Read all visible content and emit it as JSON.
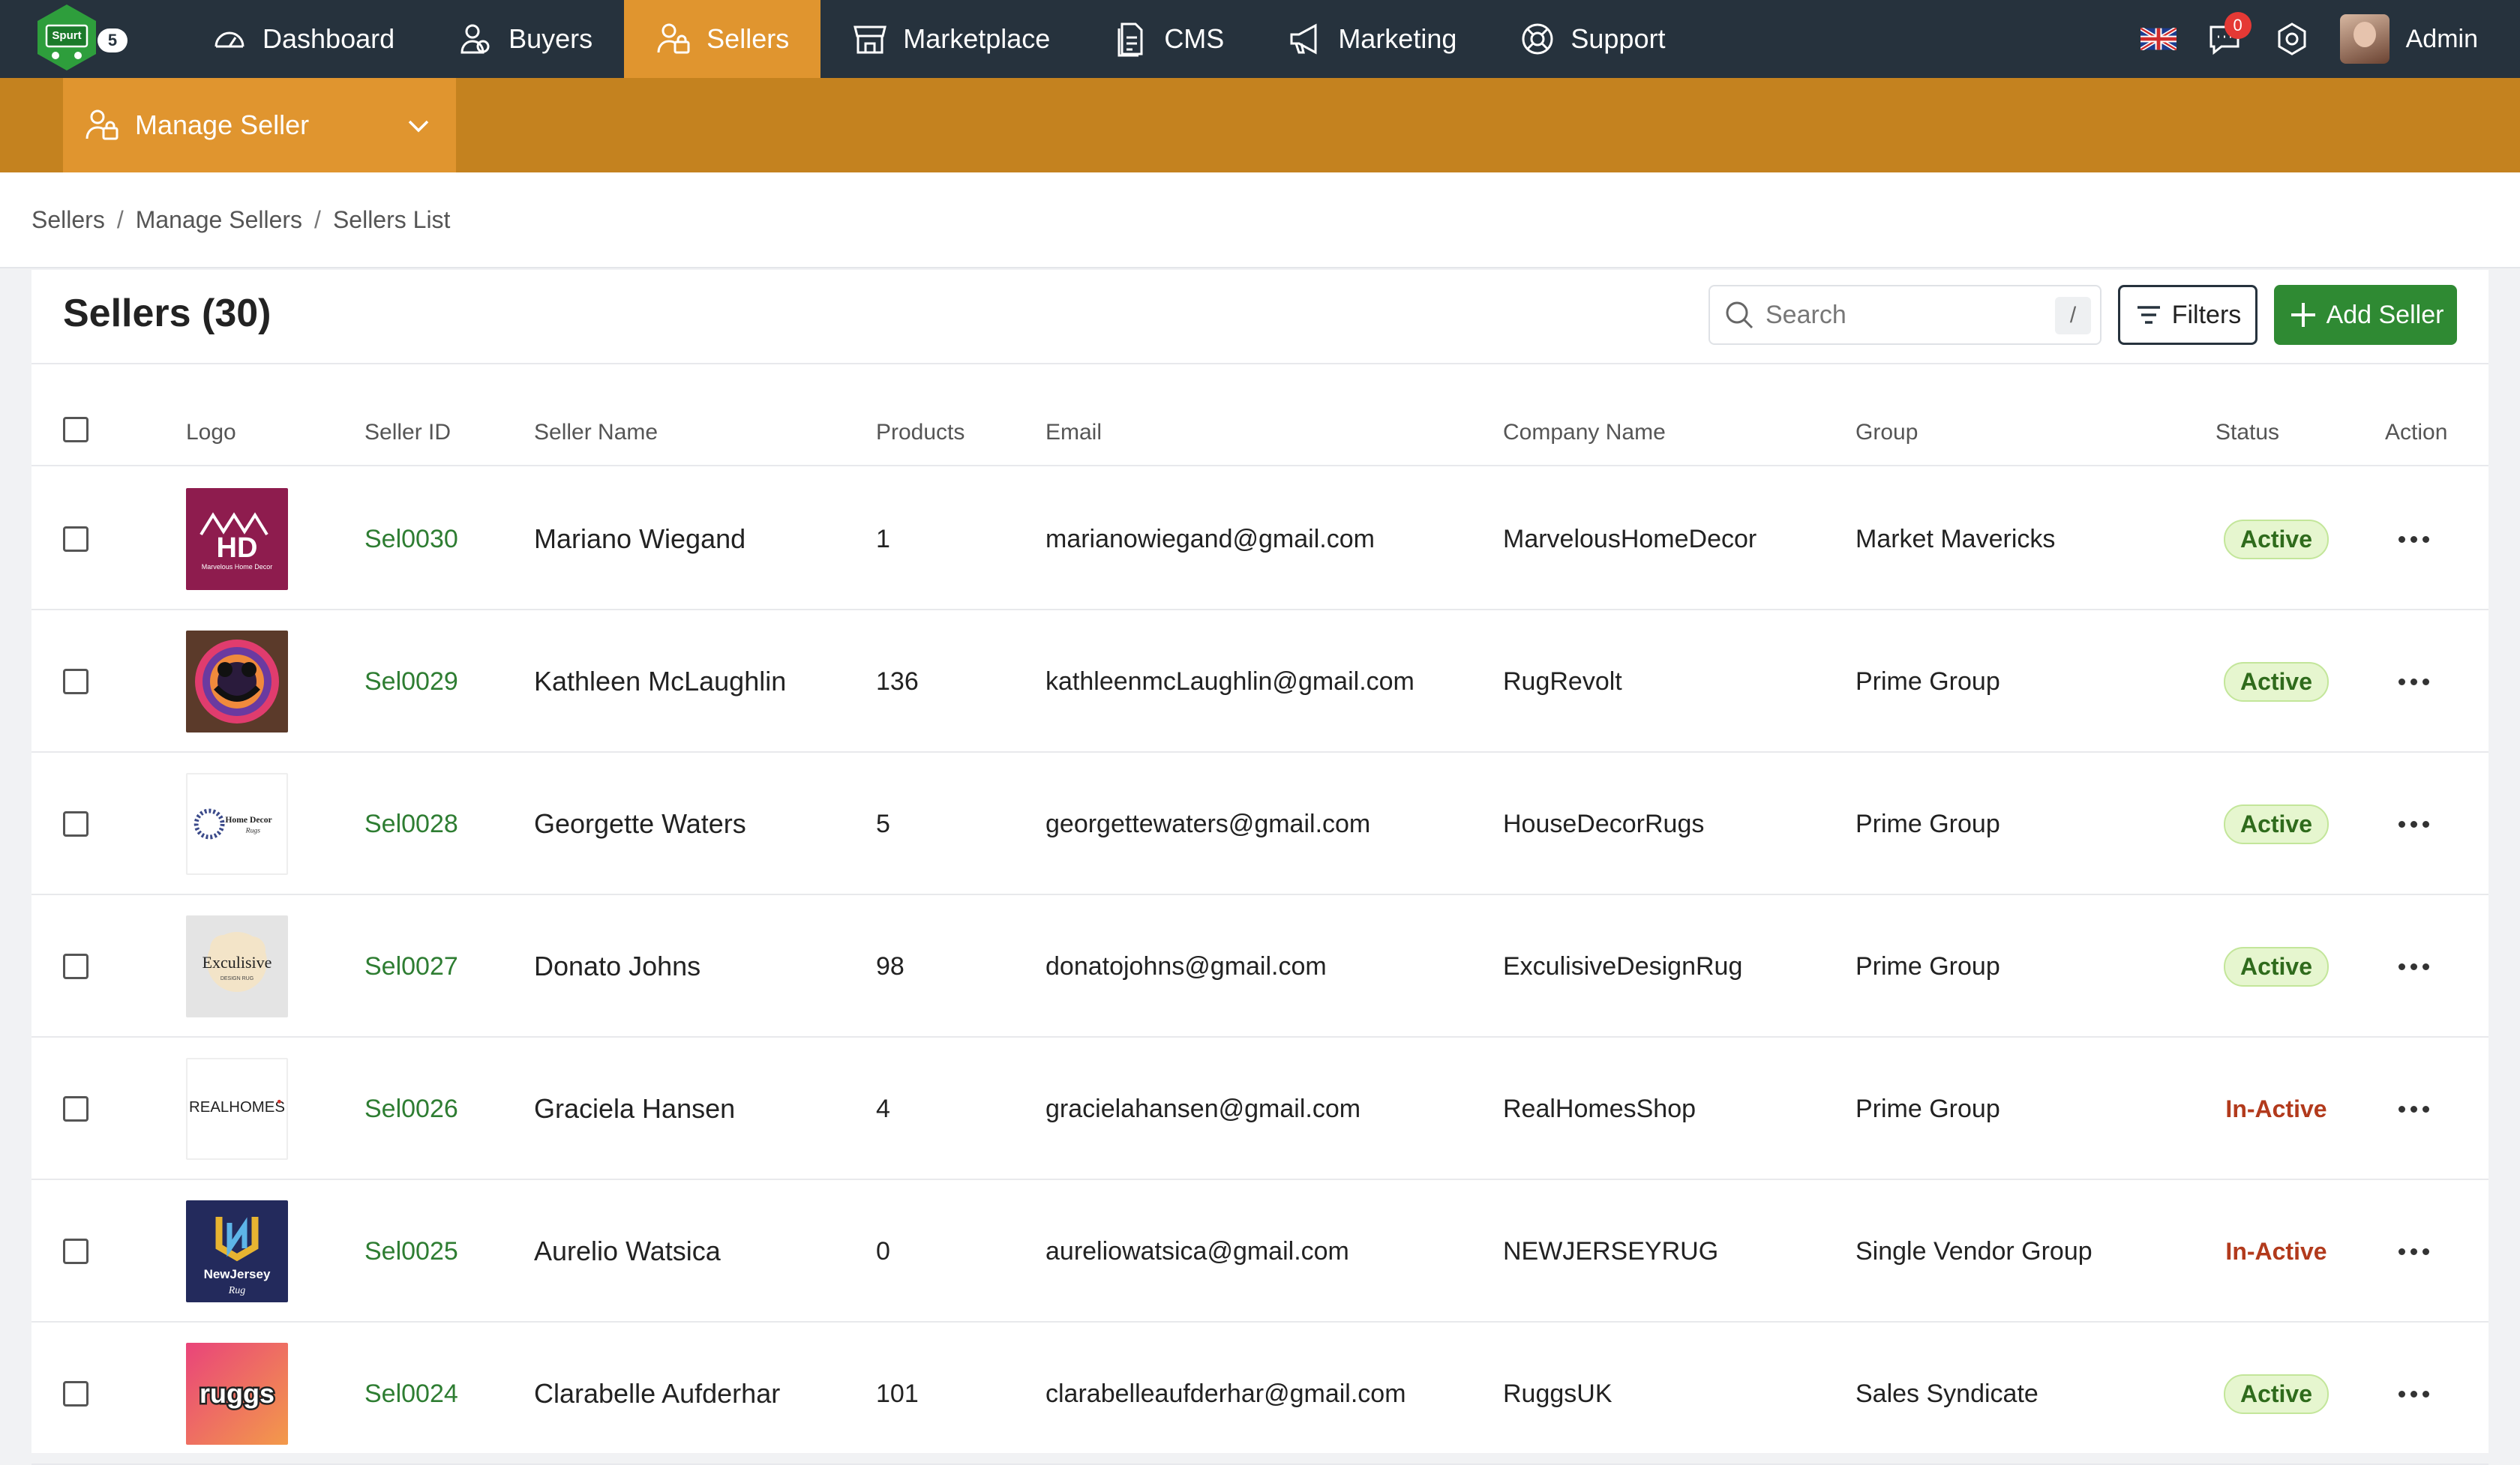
{
  "brand": {
    "logo_text": "Spurt",
    "badge": "5"
  },
  "nav": {
    "items": [
      {
        "label": "Dashboard",
        "icon": "gauge-icon",
        "active": false
      },
      {
        "label": "Buyers",
        "icon": "users-icon",
        "active": false
      },
      {
        "label": "Sellers",
        "icon": "seller-icon",
        "active": true
      },
      {
        "label": "Marketplace",
        "icon": "store-icon",
        "active": false
      },
      {
        "label": "CMS",
        "icon": "document-icon",
        "active": false
      },
      {
        "label": "Marketing",
        "icon": "megaphone-icon",
        "active": false
      },
      {
        "label": "Support",
        "icon": "lifebuoy-icon",
        "active": false
      }
    ],
    "notification_count": "0",
    "user_name": "Admin"
  },
  "subnav": {
    "label": "Manage Seller"
  },
  "breadcrumb": {
    "items": [
      "Sellers",
      "Manage Sellers",
      "Sellers List"
    ]
  },
  "page": {
    "title": "Sellers (30)",
    "search_placeholder": "Search",
    "search_shortcut": "/",
    "filters_label": "Filters",
    "add_label": "Add Seller"
  },
  "table": {
    "headers": {
      "logo": "Logo",
      "seller_id": "Seller ID",
      "seller_name": "Seller Name",
      "products": "Products",
      "email": "Email",
      "company": "Company Name",
      "group": "Group",
      "status": "Status",
      "action": "Action"
    },
    "rows": [
      {
        "logo": "HD",
        "logo_caption": "Marvelous Home Decor",
        "seller_id": "Sel0030",
        "name": "Mariano Wiegand",
        "products": "1",
        "email": "marianowiegand@gmail.com",
        "company": "MarvelousHomeDecor",
        "group": "Market Mavericks",
        "status": "Active"
      },
      {
        "logo": "",
        "logo_caption": "",
        "seller_id": "Sel0029",
        "name": "Kathleen McLaughlin",
        "products": "136",
        "email": "kathleenmcLaughlin@gmail.com",
        "company": "RugRevolt",
        "group": "Prime Group",
        "status": "Active"
      },
      {
        "logo": "Home Decor",
        "logo_caption": "Rugs",
        "seller_id": "Sel0028",
        "name": "Georgette Waters",
        "products": "5",
        "email": "georgettewaters@gmail.com",
        "company": "HouseDecorRugs",
        "group": "Prime Group",
        "status": "Active"
      },
      {
        "logo": "Exculisive",
        "logo_caption": "DESIGN RUG",
        "seller_id": "Sel0027",
        "name": "Donato Johns",
        "products": "98",
        "email": "donatojohns@gmail.com",
        "company": "ExculisiveDesignRug",
        "group": "Prime Group",
        "status": "Active"
      },
      {
        "logo": "REALHOMES",
        "logo_caption": "",
        "seller_id": "Sel0026",
        "name": "Graciela Hansen",
        "products": "4",
        "email": "gracielahansen@gmail.com",
        "company": "RealHomesShop",
        "group": "Prime Group",
        "status": "In-Active"
      },
      {
        "logo": "NewJersey",
        "logo_caption": "Rug",
        "seller_id": "Sel0025",
        "name": "Aurelio Watsica",
        "products": "0",
        "email": "aureliowatsica@gmail.com",
        "company": "NEWJERSEYRUG",
        "group": "Single Vendor Group",
        "status": "In-Active"
      },
      {
        "logo": "ruggs",
        "logo_caption": "",
        "seller_id": "Sel0024",
        "name": "Clarabelle Aufderhar",
        "products": "101",
        "email": "clarabelleaufderhar@gmail.com",
        "company": "RuggsUK",
        "group": "Sales Syndicate",
        "status": "Active"
      }
    ]
  }
}
